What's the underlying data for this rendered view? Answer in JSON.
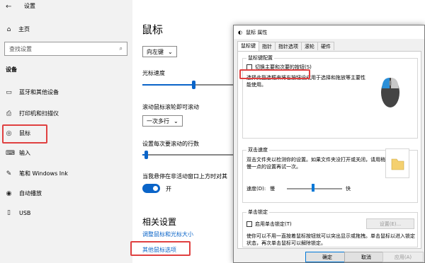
{
  "settings": {
    "window_title": "设置",
    "home_label": "主页",
    "search_placeholder": "查找设置",
    "group_label": "设备",
    "nav_items": [
      {
        "label": "蓝牙和其他设备",
        "icon": "bluetooth-icon"
      },
      {
        "label": "打印机和扫描仪",
        "icon": "printer-icon"
      },
      {
        "label": "鼠标",
        "icon": "mouse-icon"
      },
      {
        "label": "输入",
        "icon": "keyboard-icon"
      },
      {
        "label": "笔和 Windows Ink",
        "icon": "pen-icon"
      },
      {
        "label": "自动播放",
        "icon": "autoplay-icon"
      },
      {
        "label": "USB",
        "icon": "usb-icon"
      }
    ]
  },
  "main": {
    "title": "鼠标",
    "primary_button_value": "向左键",
    "cursor_speed_label": "光标速度",
    "cursor_speed_fraction": 0.56,
    "scroll_label": "滚动鼠标滚轮即可滚动",
    "scroll_value": "一次多行",
    "lines_label": "设置每次要滚动的行数",
    "lines_fraction": 0.04,
    "hover_label": "当我悬停在非活动窗口上方时对其",
    "toggle_state": "开",
    "related_title": "相关设置",
    "link_1": "调整鼠标和光标大小",
    "link_2": "其他鼠标选项"
  },
  "dialog": {
    "title": "鼠标 属性",
    "tabs": [
      "鼠标键",
      "指针",
      "指针选项",
      "滚轮",
      "硬件"
    ],
    "button_config": {
      "legend": "鼠标键配置",
      "checkbox_label": "切换主要和次要的按钮(S)",
      "description": "选择此复选框来将右按钮设成用于选择和拖放等主要性能使用。"
    },
    "double_click": {
      "legend": "双击速度",
      "description": "双击文件夹以检测你的设置。如果文件夹没打开或关闭，请用稍慢一点的设置再试一次。",
      "speed_label": "速度(D):",
      "slow_label": "慢",
      "fast_label": "快",
      "speed_fraction": 0.48
    },
    "click_lock": {
      "legend": "单击锁定",
      "checkbox_label": "启用单击锁定(T)",
      "settings_button": "设置(E)...",
      "description": "使你可以不用一直按着鼠标按钮就可以突出显示或拖拽。单击鼠标以进入锁定状态，再次单击鼠标可以解除锁定。"
    },
    "buttons": {
      "ok": "确定",
      "cancel": "取消",
      "apply": "应用(A)"
    }
  }
}
